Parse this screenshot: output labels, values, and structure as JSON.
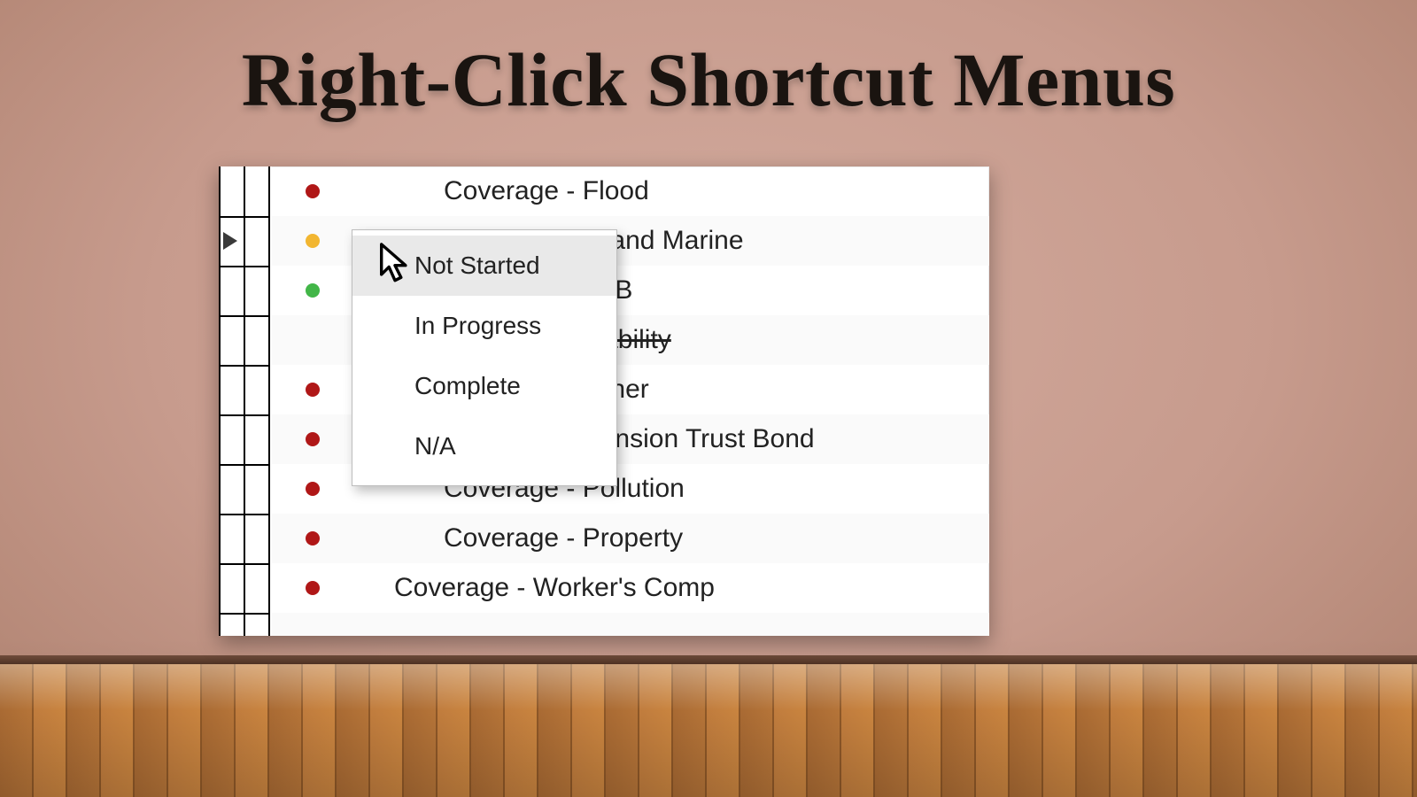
{
  "slide": {
    "title": "Right-Click Shortcut Menus"
  },
  "rows": [
    {
      "dot": "red",
      "label": "Coverage - Flood",
      "strike": false,
      "selected": false
    },
    {
      "dot": "orange",
      "label": "Coverage - Inland Marine",
      "strike": false,
      "selected": true
    },
    {
      "dot": "green",
      "label": "Coverage - IWB",
      "strike": false,
      "selected": false
    },
    {
      "dot": "none",
      "label": "Coverage - Liability",
      "strike": true,
      "selected": false
    },
    {
      "dot": "red",
      "label": "Coverage - Other",
      "strike": false,
      "selected": false
    },
    {
      "dot": "red",
      "label": "Coverage - Pension Trust Bond",
      "strike": false,
      "selected": false
    },
    {
      "dot": "red",
      "label": "Coverage - Pollution",
      "strike": false,
      "selected": false
    },
    {
      "dot": "red",
      "label": "Coverage - Property",
      "strike": false,
      "selected": false
    },
    {
      "dot": "red",
      "label": "Coverage - Worker's Comp",
      "strike": false,
      "selected": false
    }
  ],
  "contextMenu": {
    "items": [
      {
        "label": "Not Started",
        "hover": true
      },
      {
        "label": "In Progress",
        "hover": false
      },
      {
        "label": "Complete",
        "hover": false
      },
      {
        "label": "N/A",
        "hover": false
      }
    ]
  },
  "colors": {
    "red": "#b01717",
    "orange": "#f2b631",
    "green": "#42b648"
  }
}
